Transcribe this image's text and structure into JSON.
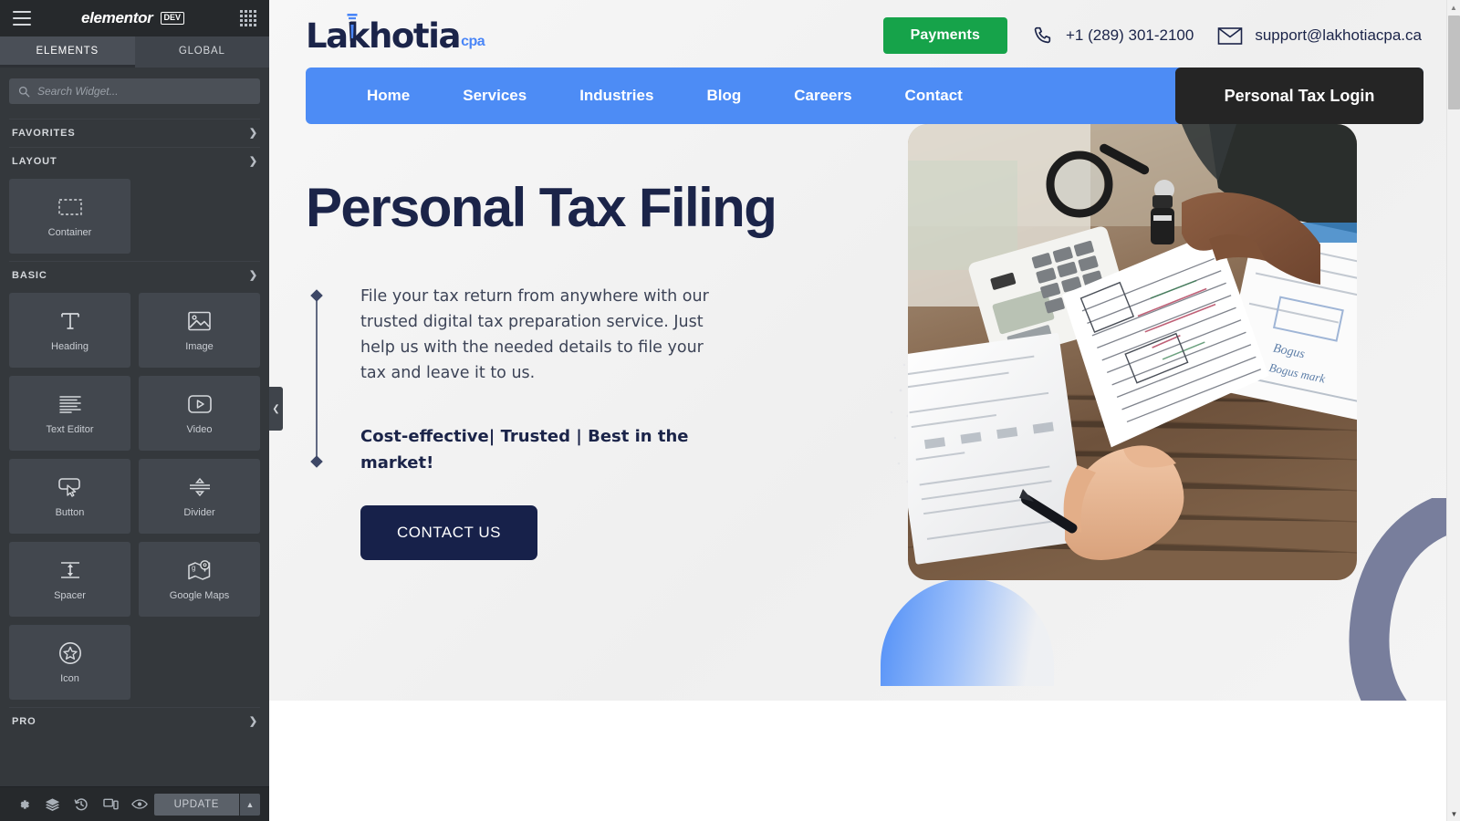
{
  "editor": {
    "brand": "elementor",
    "badge": "DEV",
    "menu_icon": "hamburger-icon",
    "apps_icon": "grid-apps-icon",
    "tabs": [
      {
        "label": "ELEMENTS",
        "active": true
      },
      {
        "label": "GLOBAL",
        "active": false
      }
    ],
    "search": {
      "placeholder": "Search Widget...",
      "value": "",
      "icon": "search-icon"
    },
    "sections": [
      {
        "label": "FAVORITES",
        "state": "collapsed",
        "chevron": "chevron-right-icon"
      },
      {
        "label": "LAYOUT",
        "state": "expanded",
        "chevron": "chevron-down-icon"
      },
      {
        "label": "BASIC",
        "state": "expanded",
        "chevron": "chevron-down-icon"
      },
      {
        "label": "PRO",
        "state": "collapsed",
        "chevron": "chevron-down-icon"
      }
    ],
    "layout_widgets": [
      {
        "label": "Container",
        "icon": "container-icon"
      }
    ],
    "basic_widgets": [
      {
        "label": "Heading",
        "icon": "heading-t-icon"
      },
      {
        "label": "Image",
        "icon": "image-icon"
      },
      {
        "label": "Text Editor",
        "icon": "text-editor-icon"
      },
      {
        "label": "Video",
        "icon": "video-play-icon"
      },
      {
        "label": "Button",
        "icon": "button-cursor-icon"
      },
      {
        "label": "Divider",
        "icon": "divider-icon"
      },
      {
        "label": "Spacer",
        "icon": "spacer-icon"
      },
      {
        "label": "Google Maps",
        "icon": "google-maps-icon"
      },
      {
        "label": "Icon",
        "icon": "star-circle-icon"
      }
    ],
    "footer": {
      "buttons": [
        {
          "name": "settings",
          "icon": "gear-icon"
        },
        {
          "name": "navigator",
          "icon": "layers-icon"
        },
        {
          "name": "history",
          "icon": "history-clock-icon"
        },
        {
          "name": "responsive",
          "icon": "responsive-mode-icon"
        },
        {
          "name": "preview",
          "icon": "eye-icon"
        }
      ],
      "update_label": "UPDATE",
      "update_caret": "caret-up-icon"
    },
    "collapse_handle": "chevron-left-icon"
  },
  "site": {
    "logo": {
      "name": "Lakhotia",
      "suffix": "cpa",
      "nib_icon": "pen-nib-icon"
    },
    "payments_button": "Payments",
    "phone": {
      "value": "+1 (289) 301-2100",
      "icon": "phone-icon"
    },
    "email": {
      "value": "support@lakhotiacpa.ca",
      "icon": "envelope-icon"
    },
    "nav": [
      {
        "label": "Home"
      },
      {
        "label": "Services"
      },
      {
        "label": "Industries"
      },
      {
        "label": "Blog"
      },
      {
        "label": "Careers"
      },
      {
        "label": "Contact"
      }
    ],
    "login_button": "Personal Tax Login",
    "hero": {
      "title": "Personal Tax Filing",
      "paragraph": "File your tax return from anywhere with our trusted digital tax preparation service. Just help us with the needed details to file your tax and leave it to us.",
      "tagline": "Cost-effective| Trusted | Best in the market!",
      "cta_label": "CONTACT US",
      "image_alt": "accountant-reviewing-tax-documents-photo"
    }
  },
  "colors": {
    "nav_blue": "#4d8cf5",
    "navy": "#1b2449",
    "cta_navy": "#17214a",
    "payments_green": "#16a34a",
    "login_dark": "#252525",
    "panel_bg": "#34383c",
    "cpa_blue": "#4a86f7"
  },
  "scrollbar": {
    "up_icon": "caret-up-icon",
    "down_icon": "caret-down-icon",
    "position": "top"
  }
}
